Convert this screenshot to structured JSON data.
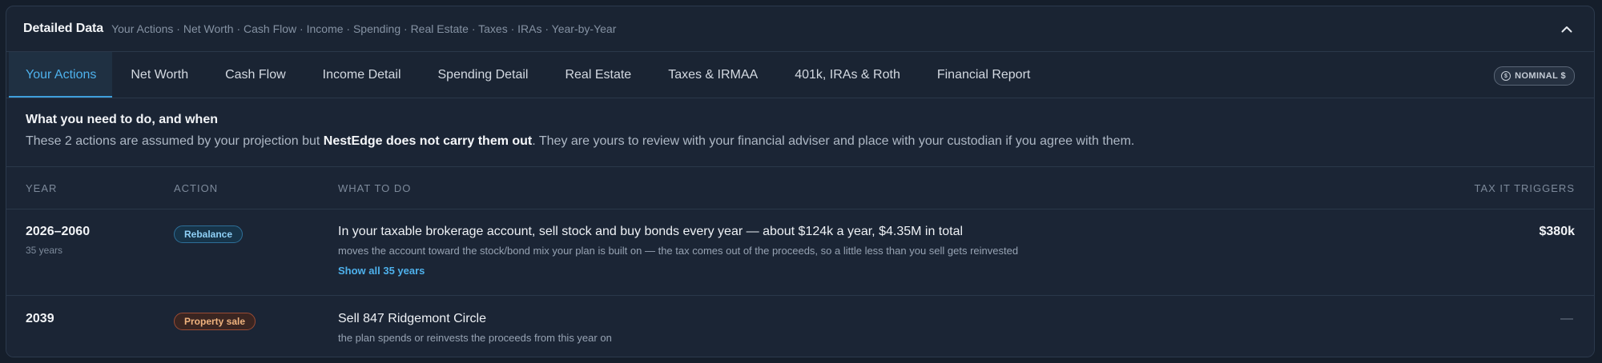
{
  "header": {
    "title": "Detailed Data",
    "subtitle": "Your Actions · Net Worth · Cash Flow · Income · Spending · Real Estate · Taxes · IRAs · Year-by-Year",
    "collapse_icon": "chevron-up-icon"
  },
  "tabs": [
    {
      "label": "Your Actions",
      "active": true
    },
    {
      "label": "Net Worth",
      "active": false
    },
    {
      "label": "Cash Flow",
      "active": false
    },
    {
      "label": "Income Detail",
      "active": false
    },
    {
      "label": "Spending Detail",
      "active": false
    },
    {
      "label": "Real Estate",
      "active": false
    },
    {
      "label": "Taxes & IRMAA",
      "active": false
    },
    {
      "label": "401k, IRAs & Roth",
      "active": false
    },
    {
      "label": "Financial Report",
      "active": false
    }
  ],
  "badge": {
    "label": "NOMINAL $",
    "icon": "coin-icon"
  },
  "intro": {
    "title": "What you need to do, and when",
    "text_before": "These 2 actions are assumed by your projection but ",
    "text_bold": "NestEdge does not carry them out",
    "text_after": ". They are yours to review with your financial adviser and place with your custodian if you agree with them."
  },
  "table": {
    "columns": {
      "year": "YEAR",
      "action": "ACTION",
      "what": "WHAT TO DO",
      "tax": "TAX IT TRIGGERS"
    },
    "rows": [
      {
        "year": "2026–2060",
        "year_sub": "35 years",
        "action": "Rebalance",
        "what": "In your taxable brokerage account, sell stock and buy bonds every year — about $124k a year, $4.35M in total",
        "what_sub": "moves the account toward the stock/bond mix your plan is built on — the tax comes out of the proceeds, so a little less than you sell gets reinvested",
        "link": "Show all 35 years",
        "tax": "$380k"
      },
      {
        "year": "2039",
        "action": "Property sale",
        "what": "Sell 847 Ridgemont Circle",
        "what_sub": "the plan spends or reinvests the proceeds from this year on",
        "tax": "—"
      }
    ]
  },
  "colors": {
    "accent": "#4eb1ec",
    "background": "#1a2433",
    "rebalance_pill": "#8fd0f6",
    "property_pill": "#f0b37e"
  }
}
